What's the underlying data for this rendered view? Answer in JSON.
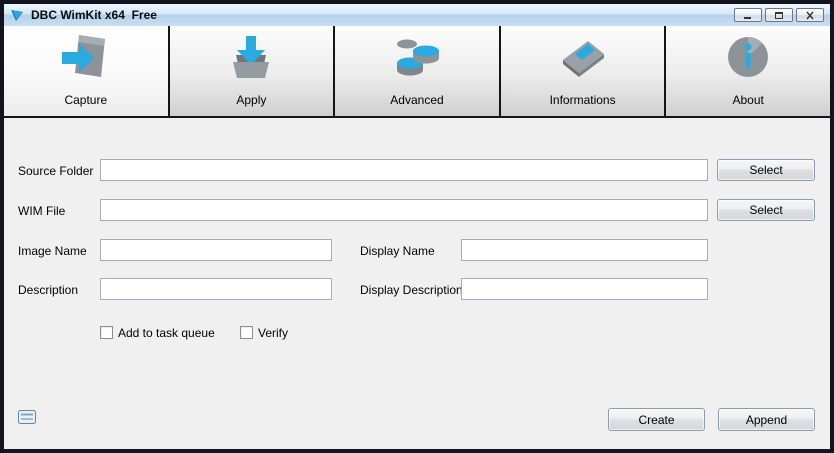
{
  "window": {
    "title": "DBC WimKit x64  Free",
    "logo_icon": "wimkit-logo-icon",
    "controls": {
      "minimize": "minimize-icon",
      "maximize": "maximize-icon",
      "close": "close-icon"
    }
  },
  "tabs": [
    {
      "label": "Capture",
      "icon": "capture-arrow-page-icon",
      "active": true
    },
    {
      "label": "Apply",
      "icon": "apply-download-tray-icon",
      "active": false
    },
    {
      "label": "Advanced",
      "icon": "advanced-disc-stack-icon",
      "active": false
    },
    {
      "label": "Informations",
      "icon": "informations-box-icon",
      "active": false
    },
    {
      "label": "About",
      "icon": "about-info-disc-icon",
      "active": false
    }
  ],
  "form": {
    "source_folder": {
      "label": "Source Folder",
      "value": "",
      "select_button": "Select"
    },
    "wim_file": {
      "label": "WIM File",
      "value": "",
      "select_button": "Select"
    },
    "image_name": {
      "label": "Image Name",
      "value": ""
    },
    "display_name": {
      "label": "Display Name",
      "value": ""
    },
    "description": {
      "label": "Description",
      "value": ""
    },
    "display_description": {
      "label": "Display Description",
      "value": ""
    },
    "add_to_task_queue": {
      "label": "Add to task queue",
      "checked": false
    },
    "verify": {
      "label": "Verify",
      "checked": false
    }
  },
  "footer": {
    "panel_icon": "log-panel-icon",
    "create_button": "Create",
    "append_button": "Append"
  },
  "colors": {
    "accent_cyan": "#29abe2",
    "icon_gray": "#8d9499",
    "frame_dark": "#14141e",
    "panel_gray": "#f0f0f0",
    "titlebar_blue": "#c9def1"
  }
}
